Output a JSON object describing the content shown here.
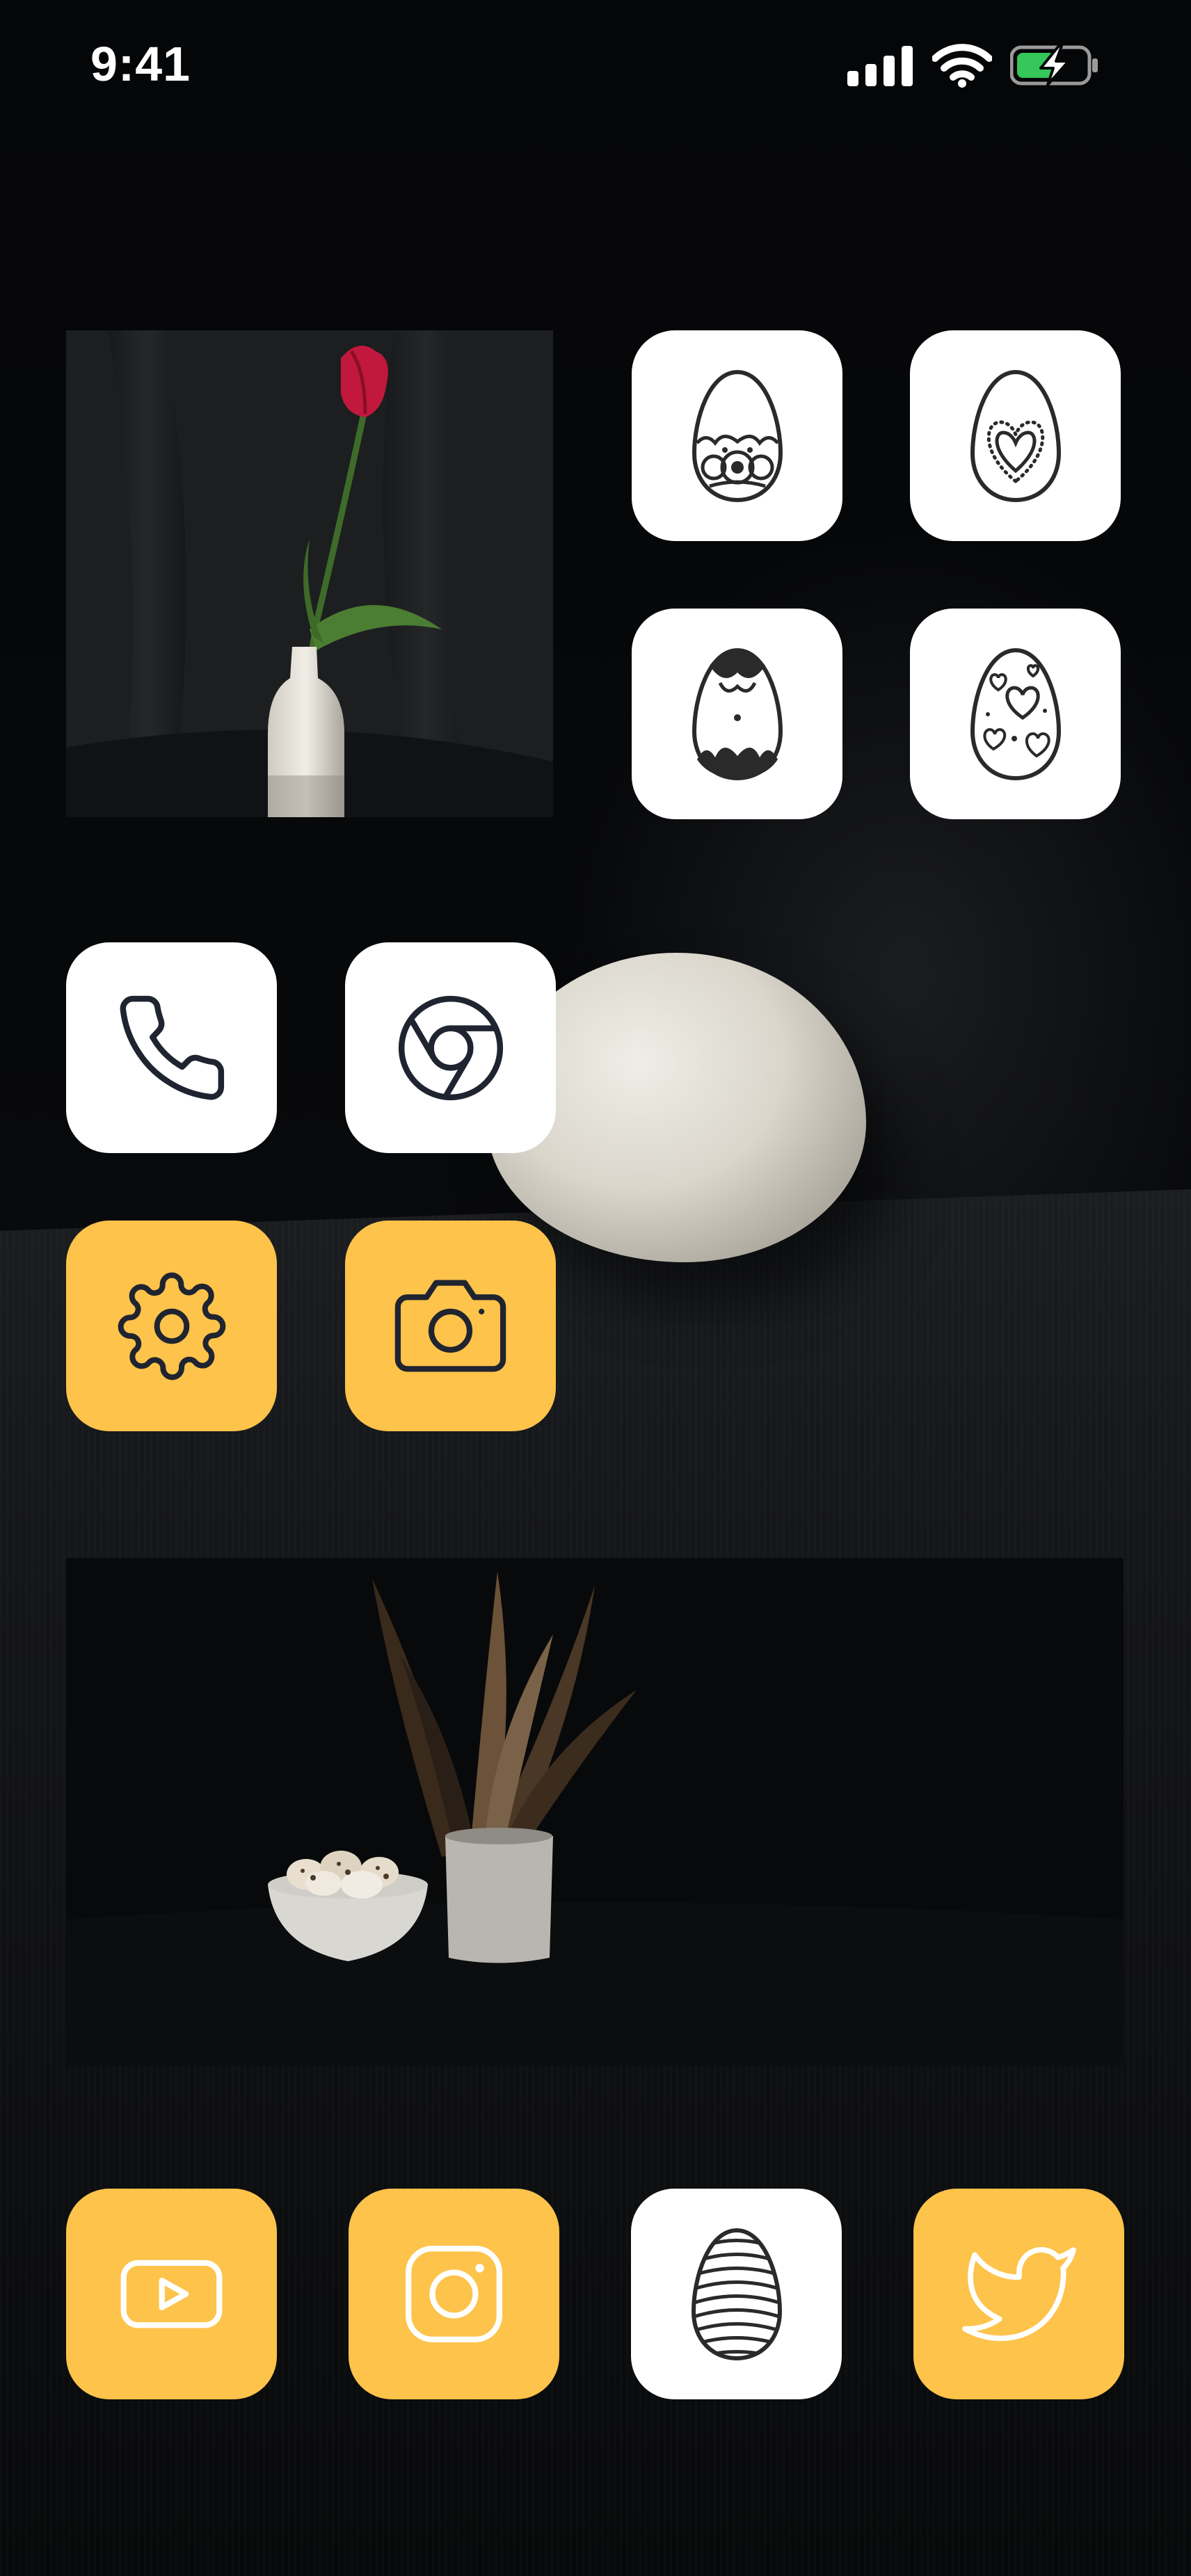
{
  "status_bar": {
    "time": "9:41",
    "icons": [
      "cellular-signal-icon",
      "wifi-icon",
      "battery-charging-icon"
    ]
  },
  "colors": {
    "icon_white": "#ffffff",
    "icon_yellow": "#fdc34a",
    "glyph_dark": "#1f2430",
    "battery_green": "#35c759"
  },
  "home_screen": {
    "widgets": [
      {
        "name": "tulip-photo-widget",
        "content": "tulip-vase-photo"
      },
      {
        "name": "quail-eggs-photo-widget",
        "content": "quail-eggs-feathers-photo"
      }
    ],
    "apps": [
      {
        "id": "egg-lace",
        "icon": "easter-egg-lace-icon",
        "style": "white"
      },
      {
        "id": "egg-heart",
        "icon": "easter-egg-heart-icon",
        "style": "white"
      },
      {
        "id": "egg-flower",
        "icon": "easter-egg-flower-icon",
        "style": "white"
      },
      {
        "id": "egg-hearts",
        "icon": "easter-egg-hearts-icon",
        "style": "white"
      },
      {
        "id": "phone",
        "icon": "phone-icon",
        "style": "white"
      },
      {
        "id": "chrome",
        "icon": "chrome-icon",
        "style": "white"
      },
      {
        "id": "settings",
        "icon": "gear-icon",
        "style": "yellow"
      },
      {
        "id": "camera",
        "icon": "camera-icon",
        "style": "yellow"
      }
    ],
    "dock": [
      {
        "id": "youtube",
        "icon": "youtube-icon",
        "style": "yellow"
      },
      {
        "id": "instagram",
        "icon": "instagram-icon",
        "style": "yellow"
      },
      {
        "id": "egg-striped",
        "icon": "easter-egg-striped-icon",
        "style": "white"
      },
      {
        "id": "twitter",
        "icon": "twitter-icon",
        "style": "yellow"
      }
    ]
  }
}
